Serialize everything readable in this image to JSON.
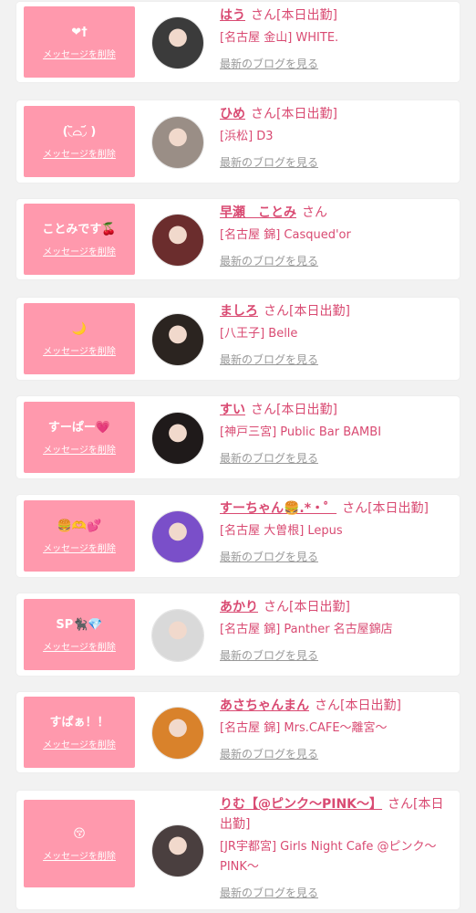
{
  "message_delete_label": "メッセージを削除",
  "blog_label": "最新のブログを見る",
  "san_label": "さん",
  "cards": [
    {
      "msg": "❤︎†",
      "name": "はう",
      "status": "[本日出勤]",
      "shop": "[名古屋 金山] WHITE.",
      "avatar_color": "#3b3b3b"
    },
    {
      "msg": "(◟᷅⌓◞᷄ )",
      "name": "ひめ",
      "status": "[本日出勤]",
      "shop": "[浜松] D3",
      "avatar_color": "#9a8e86"
    },
    {
      "msg": "ことみです🍒",
      "name": "早瀬　ことみ",
      "status": "",
      "shop": "[名古屋 錦] Casqued'or",
      "avatar_color": "#6b2d2d"
    },
    {
      "msg": "🌙",
      "name": "ましろ",
      "status": "[本日出勤]",
      "shop": "[八王子] Belle",
      "avatar_color": "#2b2420"
    },
    {
      "msg": "すーぱー💗",
      "name": "すい",
      "status": "[本日出勤]",
      "shop": "[神戸三宮] Public Bar BAMBI",
      "avatar_color": "#1f1a1a"
    },
    {
      "msg": "🍔🫶💕",
      "name": "すーちゃん🍔.*・゜",
      "status": "[本日出勤]",
      "shop": "[名古屋 大曽根] Lepus",
      "avatar_color": "#7a4fc9"
    },
    {
      "msg": "SP🐈‍⬛💎",
      "name": "あかり",
      "status": "[本日出勤]",
      "shop": "[名古屋 錦] Panther 名古屋錦店",
      "avatar_color": "#d9d9d9"
    },
    {
      "msg": "すぱぁ！！",
      "name": "あさちゃんまん",
      "status": "[本日出勤]",
      "shop": "[名古屋 錦] Mrs.CAFE〜離宮〜",
      "avatar_color": "#d9822b"
    },
    {
      "msg": "😚",
      "name": "りむ【@ピンク〜PINK〜】",
      "status": "[本日出勤]",
      "shop": "[JR宇都宮] Girls Night Cafe @ピンク〜PINK〜",
      "avatar_color": "#4a3f3f"
    }
  ]
}
